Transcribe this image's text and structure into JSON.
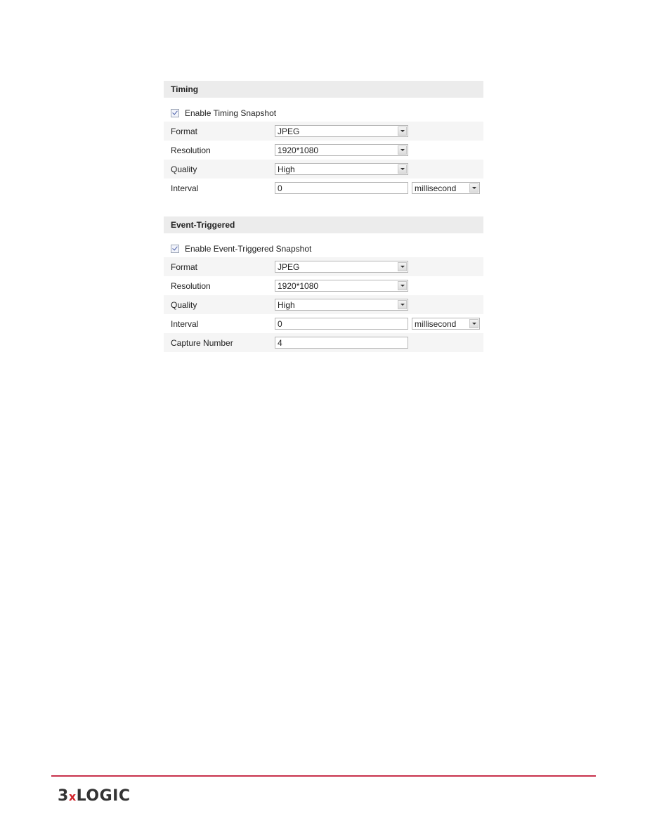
{
  "sections": [
    {
      "title": "Timing",
      "enable_label": "Enable Timing Snapshot",
      "enabled": true,
      "rows": [
        {
          "label": "Format",
          "type": "select",
          "value": "JPEG"
        },
        {
          "label": "Resolution",
          "type": "select",
          "value": "1920*1080"
        },
        {
          "label": "Quality",
          "type": "select",
          "value": "High"
        },
        {
          "label": "Interval",
          "type": "input",
          "value": "0",
          "unit": "millisecond"
        }
      ]
    },
    {
      "title": "Event-Triggered",
      "enable_label": "Enable Event-Triggered Snapshot",
      "enabled": true,
      "rows": [
        {
          "label": "Format",
          "type": "select",
          "value": "JPEG"
        },
        {
          "label": "Resolution",
          "type": "select",
          "value": "1920*1080"
        },
        {
          "label": "Quality",
          "type": "select",
          "value": "High"
        },
        {
          "label": "Interval",
          "type": "input",
          "value": "0",
          "unit": "millisecond"
        },
        {
          "label": "Capture Number",
          "type": "input",
          "value": "4"
        }
      ]
    }
  ],
  "footer": {
    "logo_prefix": "3",
    "logo_x": "x",
    "logo_suffix": "LOGIC",
    "rule_color": "#c8314b"
  }
}
